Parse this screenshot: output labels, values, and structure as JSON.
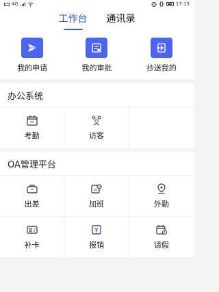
{
  "status": {
    "left_text": "4G",
    "right_text": "17:13"
  },
  "tabs": [
    {
      "label": "工作台"
    },
    {
      "label": "通讯录"
    }
  ],
  "quick": [
    {
      "label": "我的申请",
      "icon": "send-icon"
    },
    {
      "label": "我的审批",
      "icon": "approval-icon"
    },
    {
      "label": "抄送我的",
      "icon": "cc-icon"
    }
  ],
  "sections": [
    {
      "title": "办公系统",
      "items": [
        {
          "label": "考勤"
        },
        {
          "label": "访客"
        }
      ]
    },
    {
      "title": "OA管理平台",
      "items": [
        {
          "label": "出差"
        },
        {
          "label": "加班"
        },
        {
          "label": "外勤"
        },
        {
          "label": "补卡"
        },
        {
          "label": "报销"
        },
        {
          "label": "请假"
        }
      ]
    }
  ],
  "colors": {
    "accent": "#3b55e6",
    "icon_bg": "#4d63f2"
  }
}
